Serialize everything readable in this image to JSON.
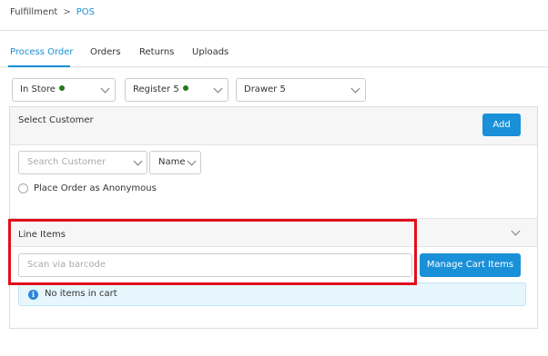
{
  "breadcrumb": {
    "parent": "Fulfillment",
    "separator": ">",
    "current": "POS"
  },
  "tabs": [
    {
      "label": "Process Order",
      "active": true
    },
    {
      "label": "Orders",
      "active": false
    },
    {
      "label": "Returns",
      "active": false
    },
    {
      "label": "Uploads",
      "active": false
    }
  ],
  "selectors": {
    "store": {
      "value": "In Store",
      "status": "online",
      "status_color": "#1d7a1d"
    },
    "register": {
      "value": "Register 5",
      "status": "online",
      "status_color": "#1d7a1d"
    },
    "drawer": {
      "value": "Drawer 5"
    }
  },
  "customer": {
    "title": "Select Customer",
    "add_label": "Add",
    "search_placeholder": "Search Customer",
    "search_by": "Name",
    "anonymous_label": "Place Order as Anonymous"
  },
  "line_items": {
    "title": "Line Items",
    "barcode_placeholder": "Scan via barcode",
    "manage_label": "Manage Cart Items",
    "empty_message": "No items in cart"
  },
  "colors": {
    "accent": "#1a90d8",
    "highlight": "#e0101c"
  }
}
